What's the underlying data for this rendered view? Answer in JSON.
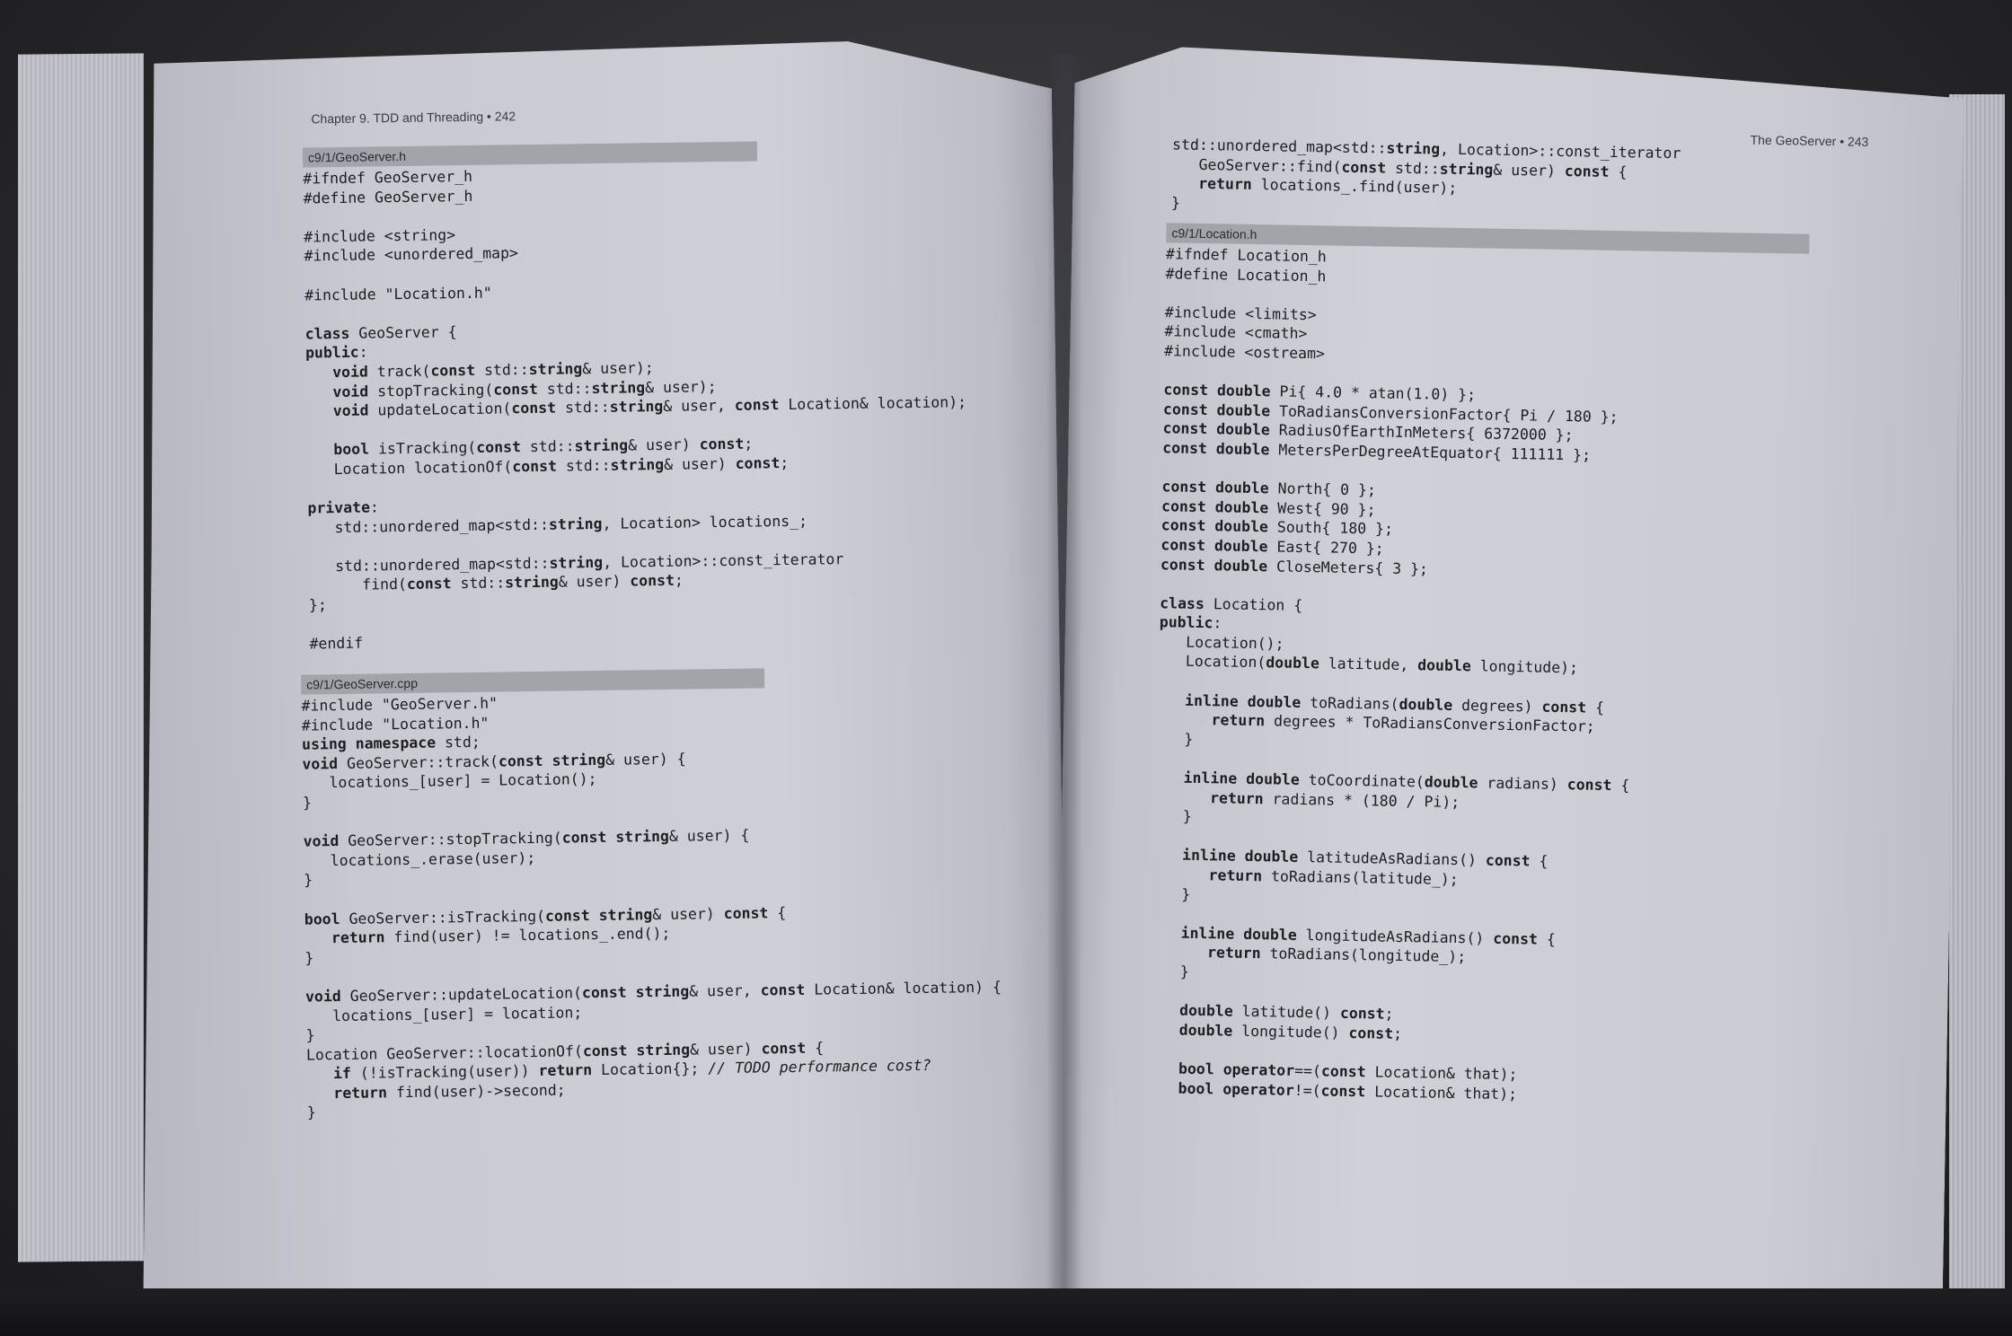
{
  "left_page": {
    "running_head": "Chapter 9. TDD and Threading • 242",
    "blocks": [
      {
        "file_label": "c9/1/GeoServer.h",
        "code": "#ifndef GeoServer_h\n#define GeoServer_h\n\n#include <string>\n#include <unordered_map>\n\n#include \"Location.h\"\n\nclass GeoServer {\npublic:\n   void track(const std::string& user);\n   void stopTracking(const std::string& user);\n   void updateLocation(const std::string& user, const Location& location);\n\n   bool isTracking(const std::string& user) const;\n   Location locationOf(const std::string& user) const;\n\nprivate:\n   std::unordered_map<std::string, Location> locations_;\n\n   std::unordered_map<std::string, Location>::const_iterator\n      find(const std::string& user) const;\n};\n\n#endif"
      },
      {
        "file_label": "c9/1/GeoServer.cpp",
        "code": "#include \"GeoServer.h\"\n#include \"Location.h\"\nusing namespace std;\nvoid GeoServer::track(const string& user) {\n   locations_[user] = Location();\n}\n\nvoid GeoServer::stopTracking(const string& user) {\n   locations_.erase(user);\n}\n\nbool GeoServer::isTracking(const string& user) const {\n   return find(user) != locations_.end();\n}\n\nvoid GeoServer::updateLocation(const string& user, const Location& location) {\n   locations_[user] = location;\n}\nLocation GeoServer::locationOf(const string& user) const {\n   if (!isTracking(user)) return Location{}; // TODO performance cost?\n   return find(user)->second;\n}"
      }
    ]
  },
  "right_page": {
    "running_head": "The GeoServer • 243",
    "blocks": [
      {
        "file_label": "",
        "code": "std::unordered_map<std::string, Location>::const_iterator\n   GeoServer::find(const std::string& user) const {\n   return locations_.find(user);\n}"
      },
      {
        "file_label": "c9/1/Location.h",
        "code": "#ifndef Location_h\n#define Location_h\n\n#include <limits>\n#include <cmath>\n#include <ostream>\n\nconst double Pi{ 4.0 * atan(1.0) };\nconst double ToRadiansConversionFactor{ Pi / 180 };\nconst double RadiusOfEarthInMeters{ 6372000 };\nconst double MetersPerDegreeAtEquator{ 111111 };\n\nconst double North{ 0 };\nconst double West{ 90 };\nconst double South{ 180 };\nconst double East{ 270 };\nconst double CloseMeters{ 3 };\n\nclass Location {\npublic:\n   Location();\n   Location(double latitude, double longitude);\n\n   inline double toRadians(double degrees) const {\n      return degrees * ToRadiansConversionFactor;\n   }\n\n   inline double toCoordinate(double radians) const {\n      return radians * (180 / Pi);\n   }\n\n   inline double latitudeAsRadians() const {\n      return toRadians(latitude_);\n   }\n\n   inline double longitudeAsRadians() const {\n      return toRadians(longitude_);\n   }\n\n   double latitude() const;\n   double longitude() const;\n\n   bool operator==(const Location& that);\n   bool operator!=(const Location& that);"
      }
    ]
  },
  "keywords": [
    "class",
    "public",
    "private",
    "const",
    "void",
    "bool",
    "return",
    "using",
    "namespace",
    "if",
    "inline",
    "double",
    "operator",
    "string"
  ]
}
